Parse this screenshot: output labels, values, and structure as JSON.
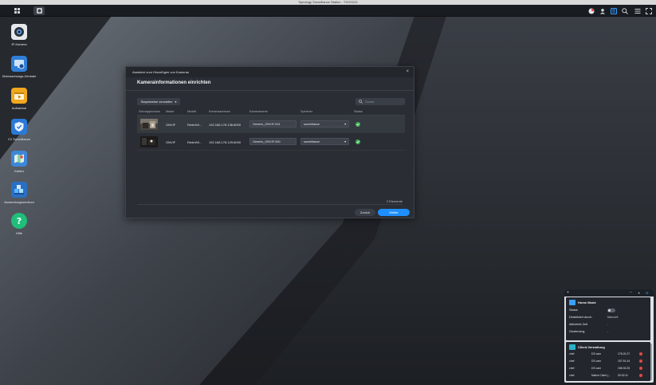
{
  "window": {
    "title": "Synology Surveillance Station - TSOS223"
  },
  "desktop_icons": [
    {
      "label": "IP-Kamera",
      "icon": "camera-icon"
    },
    {
      "label": "Überwachungs-Zentrale",
      "icon": "monitor-center-icon"
    },
    {
      "label": "Aufnahme",
      "icon": "recording-icon"
    },
    {
      "label": "C2 Surveillance",
      "icon": "shield-icon"
    },
    {
      "label": "Karten",
      "icon": "map-icon"
    },
    {
      "label": "Anwendungszentrum",
      "icon": "app-center-icon"
    },
    {
      "label": "Hilfe",
      "icon": "help-icon"
    }
  ],
  "dialog": {
    "small_title": "Assistent zum Hinzufügen von Kameras",
    "heading": "Kamerainformationen einrichten",
    "batch_button": "Stapelweise verwalten",
    "search_placeholder": "Suche",
    "columns": [
      "Schnappschuss",
      "Marke",
      "Modell",
      "Kameraadresse",
      "Kameraname",
      "Speicher",
      "Status"
    ],
    "rows": [
      {
        "brand": "ONVIF",
        "model": "RedmiVi...",
        "address": "192.168.178.136:8000",
        "name": "Generic_ONVIF-001",
        "storage": "surveillance",
        "status": "ok"
      },
      {
        "brand": "ONVIF",
        "model": "RedmiVi...",
        "address": "192.168.178.129:8000",
        "name": "Generic_ONVIF-000",
        "storage": "surveillance",
        "status": "ok"
      }
    ],
    "count": "2 Elemente",
    "back_button": "Zurück",
    "next_button": "Weiter"
  },
  "widget": {
    "home_mode": {
      "title": "Home Mode",
      "status_label": "Status",
      "deactivated_label": "Deaktiviert durch",
      "deactivated_value": "Manuell",
      "active_since_label": "Aktivierte Zeit",
      "active_since_value": "-",
      "geofencing_label": "Geofencing",
      "geofencing_value": "-"
    },
    "client": {
      "title": "Client-Verwaltung",
      "rows": [
        {
          "user": "chef",
          "client": "DS cam",
          "ip": "178.20.27"
        },
        {
          "user": "chef",
          "client": "DS cam",
          "ip": "157.51.44"
        },
        {
          "user": "chef",
          "client": "DS cam",
          "ip": "158.33.25"
        },
        {
          "user": "chef",
          "client": "Native Client (...",
          "ip": "00:02:11"
        }
      ]
    }
  },
  "colors": {
    "accent": "#1f8fff",
    "ok": "#3fae55",
    "danger": "#e04848"
  }
}
